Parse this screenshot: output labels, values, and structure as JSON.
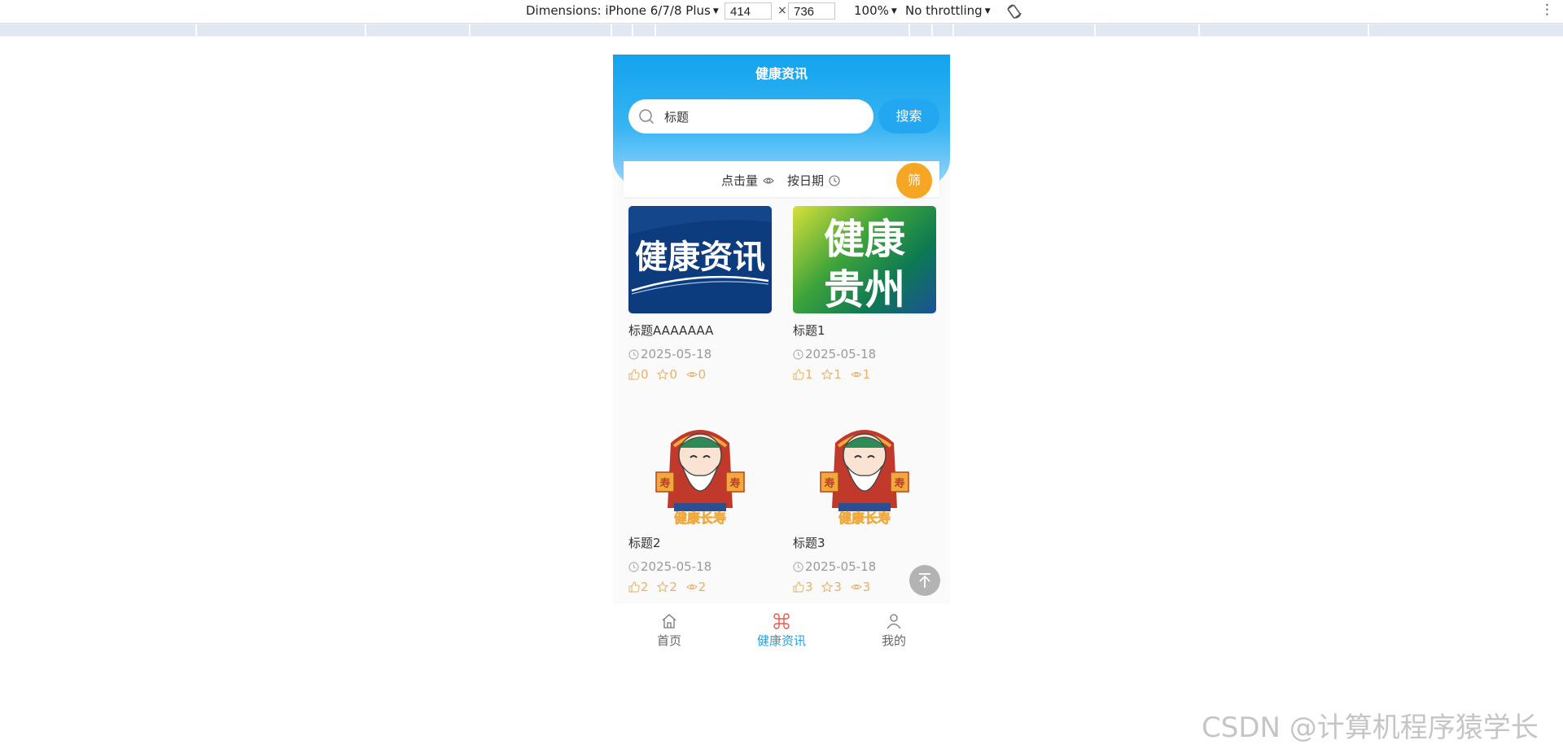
{
  "devtools": {
    "device_label": "Dimensions: iPhone 6/7/8 Plus",
    "width": "414",
    "times": "×",
    "height": "736",
    "zoom": "100%",
    "throttle": "No throttling",
    "more": "⋮"
  },
  "page": {
    "title": "健康资讯",
    "search": {
      "value": "标题",
      "button": "搜索"
    },
    "sort": {
      "by_clicks": "点击量",
      "by_date": "按日期"
    },
    "filter_button": "筛"
  },
  "cards": [
    {
      "title": "标题AAAAAAA",
      "date": "2025-05-18",
      "likes": "0",
      "favorites": "0",
      "views": "0",
      "image": "health-news-banner",
      "image_text": "健康资讯"
    },
    {
      "title": "标题1",
      "date": "2025-05-18",
      "likes": "1",
      "favorites": "1",
      "views": "1",
      "image": "healthy-guizhou-banner",
      "image_text": "健康贵州"
    },
    {
      "title": "标题2",
      "date": "2025-05-18",
      "likes": "2",
      "favorites": "2",
      "views": "2",
      "image": "longevity-god-illustration",
      "image_text": "健康长寿"
    },
    {
      "title": "标题3",
      "date": "2025-05-18",
      "likes": "3",
      "favorites": "3",
      "views": "3",
      "image": "longevity-god-illustration",
      "image_text": "健康长寿"
    }
  ],
  "tabbar": {
    "items": [
      {
        "label": "首页",
        "icon": "home-icon"
      },
      {
        "label": "健康资讯",
        "icon": "command-icon"
      },
      {
        "label": "我的",
        "icon": "user-icon"
      }
    ],
    "active": "健康资讯"
  },
  "watermark": "CSDN @计算机程序猿学长",
  "colors": {
    "accent": "#1fa3e8",
    "filter": "#f6a623",
    "stats": "#e7b166"
  }
}
